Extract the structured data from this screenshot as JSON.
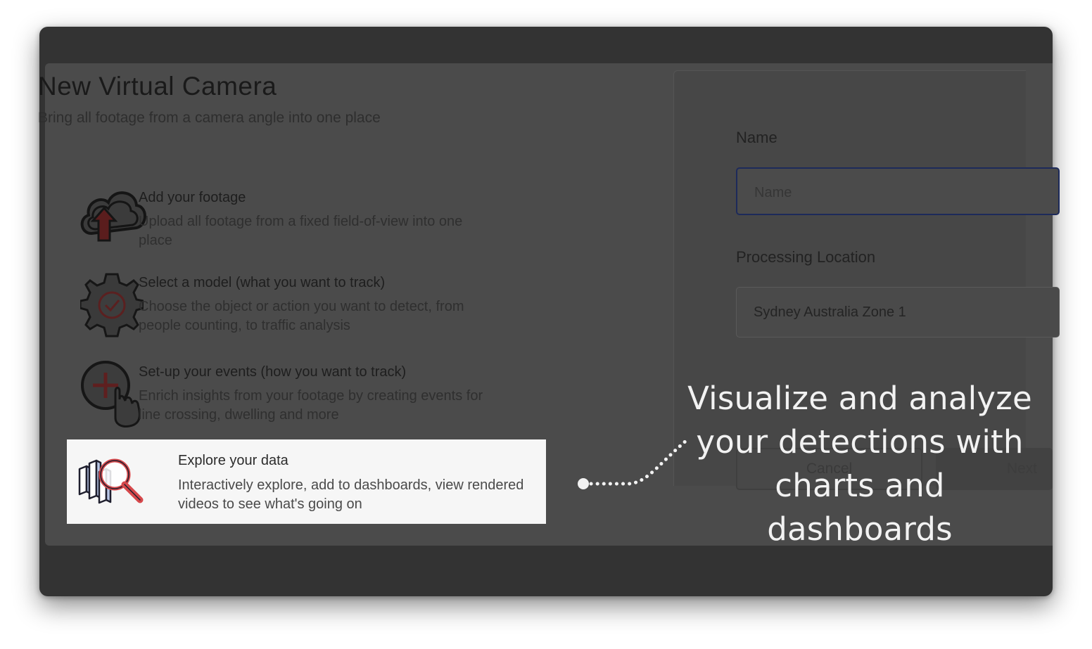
{
  "dialog": {
    "title": "New Virtual Camera",
    "subtitle": "Bring all footage from a camera angle into one place"
  },
  "steps": [
    {
      "icon": "cloud-upload-icon",
      "heading": "Add your footage",
      "description": "Upload all footage from a fixed field-of-view into one place"
    },
    {
      "icon": "gear-check-icon",
      "heading": "Select a model (what you want to track)",
      "description": "Choose the object or action you want to detect, from people counting, to traffic analysis"
    },
    {
      "icon": "add-event-hand-icon",
      "heading": "Set-up your events (how you want to track)",
      "description": "Enrich insights from your footage by creating events for line crossing, dwelling and more"
    },
    {
      "icon": "explore-data-icon",
      "heading": "Explore your data",
      "description": "Interactively explore, add to dashboards, view rendered videos to see what's going on"
    }
  ],
  "form": {
    "name_label": "Name",
    "name_placeholder": "Name",
    "location_label": "Processing Location",
    "location_value": "Sydney Australia Zone 1",
    "cancel_label": "Cancel",
    "next_label": "Next"
  },
  "callout": {
    "line1": "Visualize and analyze",
    "line2": "your detections with",
    "line3": "charts and dashboards"
  },
  "colors": {
    "overlay": "#4b4b4b",
    "highlight": "#f6f6f6",
    "accent_red": "#d6484b",
    "input_border": "#1d2a5a"
  }
}
